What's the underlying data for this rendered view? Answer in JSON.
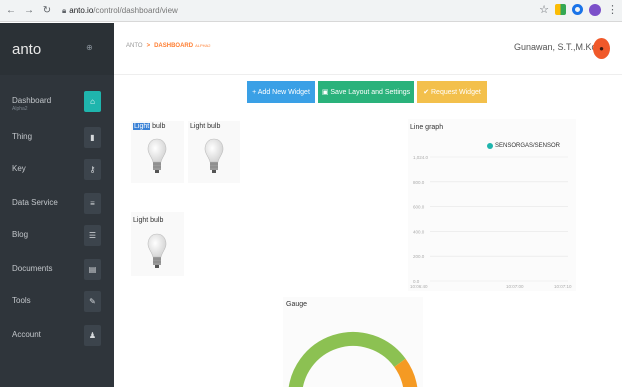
{
  "browser": {
    "url_host": "anto.io",
    "url_path": "/control/dashboard/view",
    "icons": [
      "back-icon",
      "forward-icon",
      "reload-icon",
      "lock-icon",
      "star-icon",
      "menu-icon"
    ]
  },
  "sidebar": {
    "brand": "anto",
    "items": [
      {
        "label": "Dashboard",
        "sub": "Alpha2",
        "icon": "home-icon",
        "glyph": "⌂",
        "active": true
      },
      {
        "label": "Thing",
        "icon": "device-icon",
        "glyph": "▮"
      },
      {
        "label": "Key",
        "icon": "key-icon",
        "glyph": "⚷"
      },
      {
        "label": "Data Service",
        "icon": "database-icon",
        "glyph": "≡"
      },
      {
        "label": "Blog",
        "icon": "list-icon",
        "glyph": "☰"
      },
      {
        "label": "Documents",
        "icon": "document-icon",
        "glyph": "▤"
      },
      {
        "label": "Tools",
        "icon": "wrench-icon",
        "glyph": "✎"
      },
      {
        "label": "Account",
        "icon": "user-icon",
        "glyph": "♟"
      }
    ],
    "accent_color": "#1fb5ad"
  },
  "header": {
    "breadcrumb_root": "ANTO",
    "breadcrumb_sep": ">",
    "breadcrumb_current": "DASHBOARD",
    "breadcrumb_tag": "ALPHA2",
    "username": "Gunawan, S.T.,M.Kom",
    "avatar_glyph": "●"
  },
  "actions": {
    "add_widget": "+ Add New Widget",
    "save_layout": "▣ Save Layout and Settings",
    "request_widget": "✔ Request Widget",
    "colors": {
      "add": "#3aa0e6",
      "save": "#2ab27b",
      "request": "#f3c04c"
    }
  },
  "widgets": {
    "bulb1_title_hl": "Light",
    "bulb1_title_rest": " bulb",
    "bulb2_title": "Light bulb",
    "bulb3_title": "Light bulb",
    "line_graph_title": "Line graph",
    "gauge_title": "Gauge"
  },
  "chart_data": {
    "type": "line",
    "title": "Line graph",
    "series": [
      {
        "name": "SENSORGAS/SENSOR",
        "values": [],
        "color": "#1fb5ad"
      }
    ],
    "y_ticks": [
      "1,024.0",
      "800.0",
      "600.0",
      "400.0",
      "200.0",
      "0.0"
    ],
    "x_ticks": [
      "10:06:40",
      "10:07:00",
      "10:07:10"
    ],
    "ylim": [
      0,
      1024
    ],
    "grid": true,
    "legend": "top-center"
  },
  "gauge": {
    "colors": {
      "main": "#8cc152",
      "high": "#f59a23"
    },
    "value_fraction": 0.8
  }
}
